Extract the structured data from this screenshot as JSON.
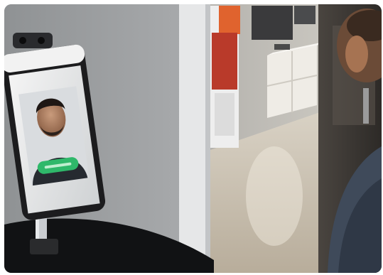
{
  "photo": {
    "subject": "facial-recognition-kiosk",
    "screen_indicator": "green-verified-badge",
    "colors": {
      "wall": "#9a9d9f",
      "corridor_floor": "#cfc7b9",
      "shelf": "#ece9e2",
      "poster_red": "#c8432b",
      "screen_frame": "#1c1c1e",
      "badge_green": "#2fb86a"
    }
  }
}
